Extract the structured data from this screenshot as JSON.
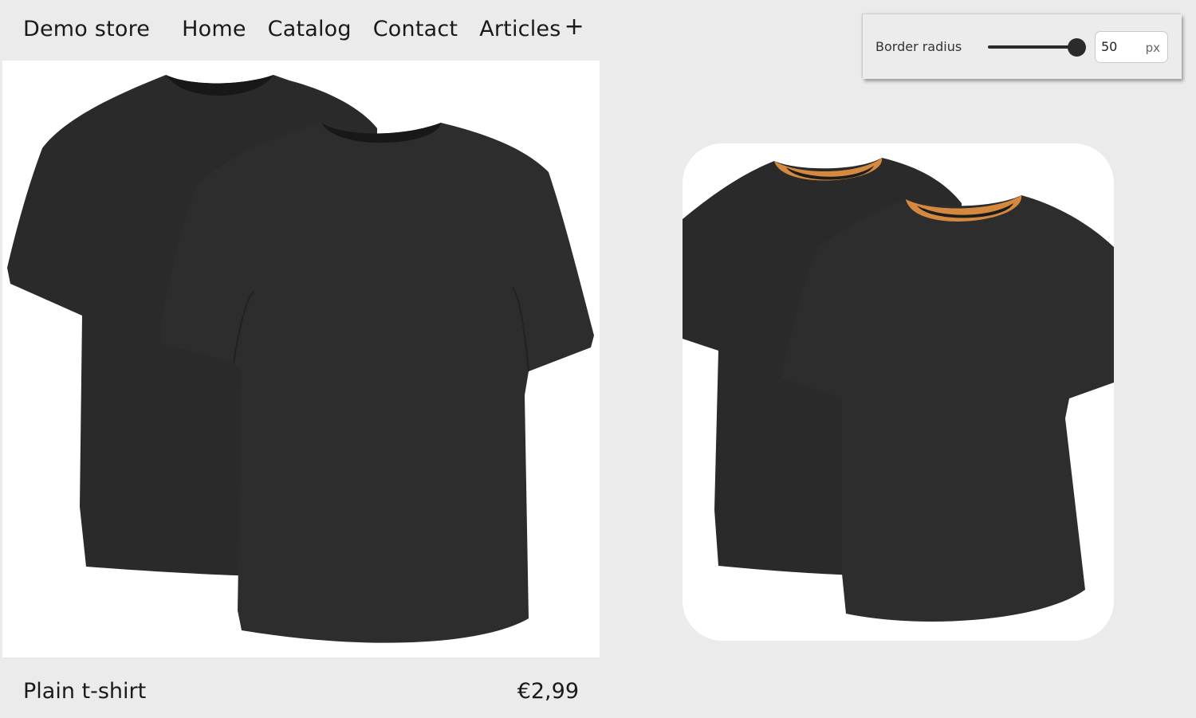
{
  "nav": {
    "brand": "Demo store",
    "links": [
      "Home",
      "Catalog",
      "Contact",
      "Articles"
    ],
    "articles_expand_icon": "plus-icon"
  },
  "product": {
    "name": "Plain t-shirt",
    "price": "€2,99",
    "image": "two-black-t-shirts"
  },
  "control": {
    "label": "Border radius",
    "value": "50",
    "unit": "px",
    "slider_fraction": 1.0
  },
  "preview": {
    "image": "two-black-t-shirts-with-orange-collars",
    "collar_color": "#d4893f"
  },
  "colors": {
    "background": "#ebebeb",
    "shirt": "#2b2b2b",
    "accent": "#d4893f"
  }
}
